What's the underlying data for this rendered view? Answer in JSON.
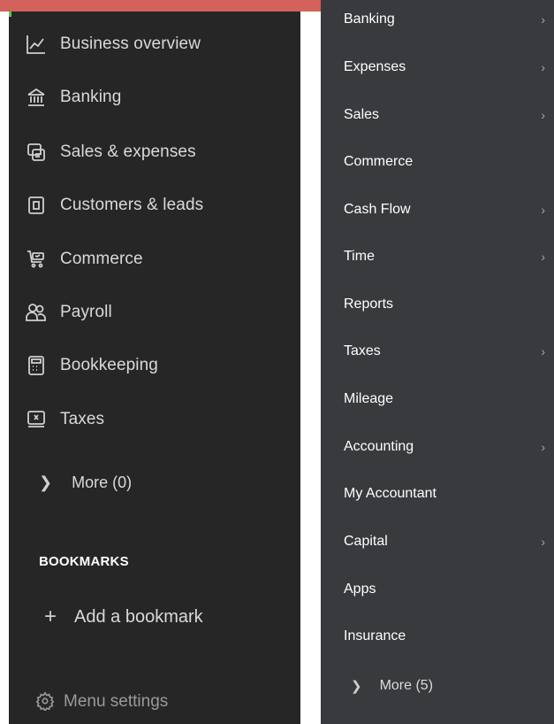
{
  "colors": {
    "top_bar": "#d2625b",
    "left_panel": "#262626",
    "right_panel": "#393a3d",
    "accent": "#5cc64a"
  },
  "left_nav": {
    "items": [
      {
        "label": "Business overview",
        "icon": "chart-line-icon"
      },
      {
        "label": "Banking",
        "icon": "bank-icon"
      },
      {
        "label": "Sales & expenses",
        "icon": "receipt-icon"
      },
      {
        "label": "Customers & leads",
        "icon": "contact-card-icon"
      },
      {
        "label": "Commerce",
        "icon": "shopping-cart-icon"
      },
      {
        "label": "Payroll",
        "icon": "people-icon"
      },
      {
        "label": "Bookkeeping",
        "icon": "calculator-icon"
      },
      {
        "label": "Taxes",
        "icon": "tax-document-icon"
      }
    ],
    "more_label": "More (0)",
    "bookmarks_heading": "BOOKMARKS",
    "add_bookmark_label": "Add a bookmark",
    "menu_settings_label": "Menu settings"
  },
  "sub_nav": {
    "items": [
      {
        "label": "Banking",
        "has_arrow": true
      },
      {
        "label": "Expenses",
        "has_arrow": true
      },
      {
        "label": "Sales",
        "has_arrow": true
      },
      {
        "label": "Commerce",
        "has_arrow": false
      },
      {
        "label": "Cash Flow",
        "has_arrow": true
      },
      {
        "label": "Time",
        "has_arrow": true
      },
      {
        "label": "Reports",
        "has_arrow": false
      },
      {
        "label": "Taxes",
        "has_arrow": true
      },
      {
        "label": "Mileage",
        "has_arrow": false
      },
      {
        "label": "Accounting",
        "has_arrow": true
      },
      {
        "label": "My Accountant",
        "has_arrow": false
      },
      {
        "label": "Capital",
        "has_arrow": true
      },
      {
        "label": "Apps",
        "has_arrow": false
      },
      {
        "label": "Insurance",
        "has_arrow": false
      }
    ],
    "more_label": "More (5)"
  }
}
